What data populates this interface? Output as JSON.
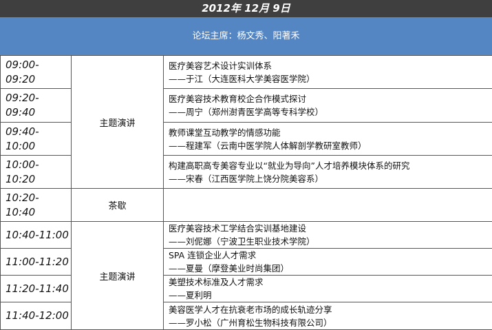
{
  "date": "2012年 12月 9日",
  "chair": "论坛主席：杨文秀、阳著禾",
  "sessions": [
    {
      "time": "09:00-\n09:20",
      "title": "医疗美容艺术设计实训体系",
      "speaker": "——于江（大连医科大学美容医学院）"
    },
    {
      "time": "09:20-\n09:40",
      "title": "医疗美容技术教育校企合作模式探讨",
      "speaker": "——周宁（郑州澍青医学高等专科学校）"
    },
    {
      "time": "09:40-\n10:00",
      "title": "教师课堂互动教学的情感功能",
      "speaker": "——程建军（云南中医学院人体解剖学教研室教师）"
    },
    {
      "time": "10:00-\n10:20",
      "title": "构建高职高专美容专业以“就业为导向”人才培养模块体系的研究",
      "speaker": "——宋春（江西医学院上饶分院美容系）"
    },
    {
      "time": "10:20-\n10:40",
      "type": "茶歇"
    },
    {
      "time": "10:40-11:00",
      "title": "医疗美容技术工学结合实训基地建设",
      "speaker": "——刘伲娜（宁波卫生职业技术学院）"
    },
    {
      "time": "11:00-11:20",
      "title": "SPA 连锁企业人才需求",
      "speaker": "——夏曼（摩登美业时尚集团）"
    },
    {
      "time": "11:20-11:40",
      "title": "美塑技术标准及人才需求",
      "speaker": "——夏利明"
    },
    {
      "time": "11:40-12:00",
      "title": "美容医学人才在抗衰老市场的成长轨迹分享",
      "speaker": "——罗小松（广州育松生物科技有限公司）"
    }
  ],
  "groups": {
    "morning_type": "主题演讲",
    "late_type": "主题演讲"
  }
}
